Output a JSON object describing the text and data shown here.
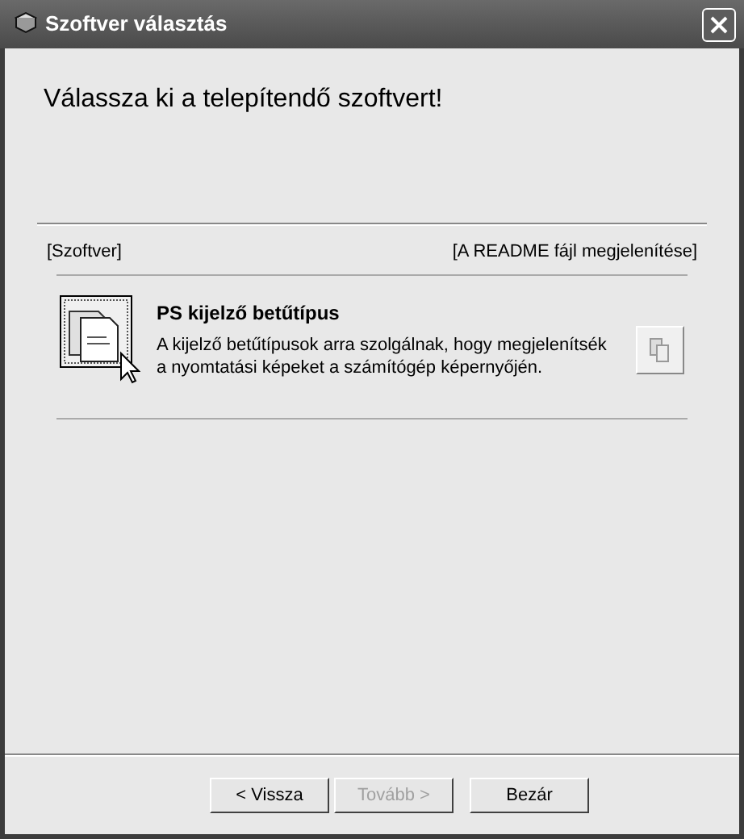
{
  "window": {
    "title": "Szoftver választás"
  },
  "heading": "Válassza ki a telepítendő szoftvert!",
  "list_header": {
    "left": "[Szoftver]",
    "right": "[A README fájl megjelenítése]"
  },
  "software": [
    {
      "name": "PS kijelző betűtípus",
      "description": "A kijelző betűtípusok arra szolgálnak, hogy megjelenítsék a nyomtatási képeket a számítógép képernyőjén.",
      "hovered": true
    }
  ],
  "buttons": [
    {
      "label": "< Vissza",
      "disabled": false
    },
    {
      "label": "Tovább >",
      "disabled": true
    },
    {
      "label": "Bezár",
      "disabled": false
    }
  ]
}
